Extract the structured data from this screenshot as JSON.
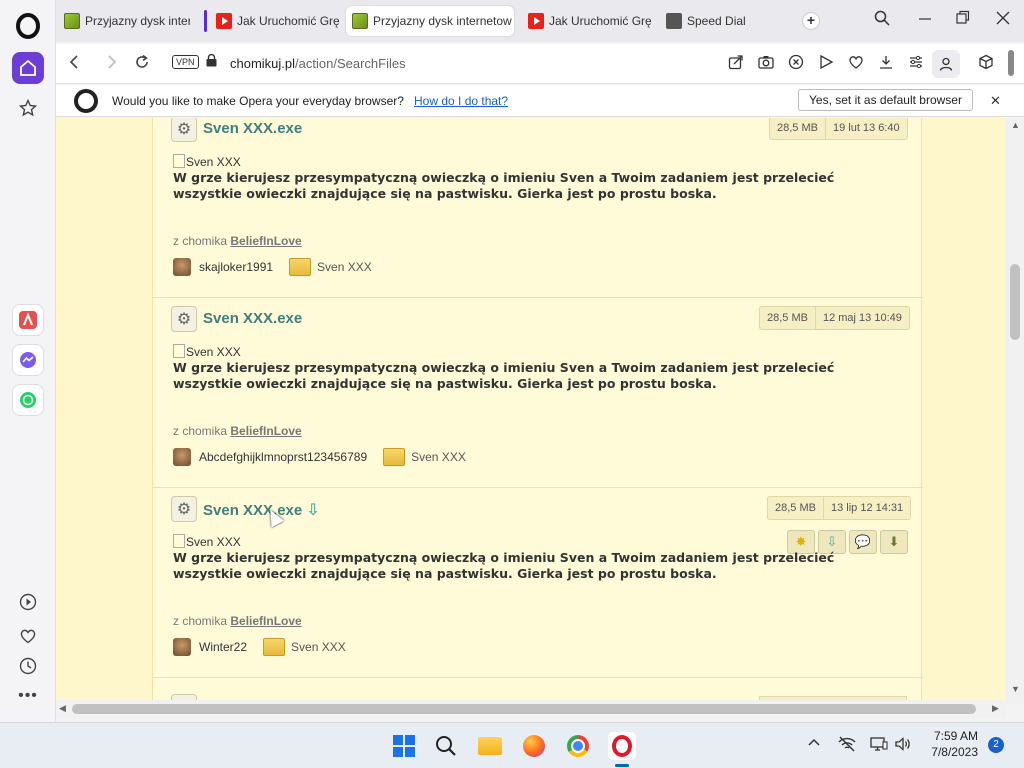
{
  "tabs": [
    {
      "label": "Przyjazny dysk intern",
      "favicon": "chomikuj-favicon",
      "active": false
    },
    {
      "label": "Jak Uruchomić Grę",
      "favicon": "youtube-favicon",
      "active": false
    },
    {
      "label": "Przyjazny dysk internetow",
      "favicon": "chomikuj-favicon",
      "active": true
    },
    {
      "label": "Jak Uruchomić Grę",
      "favicon": "youtube-favicon",
      "active": false
    },
    {
      "label": "Speed Dial",
      "favicon": "speed-dial-favicon",
      "active": false
    }
  ],
  "address": {
    "vpn_label": "VPN",
    "domain": "chomikuj.pl",
    "path": "/action/SearchFiles"
  },
  "infobar": {
    "message": "Would you like to make Opera your everyday browser?",
    "link": "How do I do that?",
    "button": "Yes, set it as default browser"
  },
  "files": [
    {
      "title": "Sven XXX.exe",
      "size": "28,5 MB",
      "date": "19 lut 13 6:40",
      "img_alt": "Sven XXX",
      "description": "W grze kierujesz przesympatyczną owieczką o imieniu Sven a Twoim zadaniem jest przelecieć wszystkie owieczki znajdujące się na pastwisku. Gierka jest po prostu boska.",
      "from_label": "z chomika",
      "from_user": "BeliefInLove",
      "owner": "skajloker1991",
      "folder": "Sven XXX"
    },
    {
      "title": "Sven XXX.exe",
      "size": "28,5 MB",
      "date": "12 maj 13 10:49",
      "img_alt": "Sven XXX",
      "description": "W grze kierujesz przesympatyczną owieczką o imieniu Sven a Twoim zadaniem jest przelecieć wszystkie owieczki znajdujące się na pastwisku. Gierka jest po prostu boska.",
      "from_label": "z chomika",
      "from_user": "BeliefInLove",
      "owner": "Abcdefghijklmnoprst123456789",
      "folder": "Sven XXX"
    },
    {
      "title": "Sven XXX.exe",
      "size": "28,5 MB",
      "date": "13 lip 12 14:31",
      "img_alt": "Sven XXX",
      "description": "W grze kierujesz przesympatyczną owieczką o imieniu Sven a Twoim zadaniem jest przelecieć wszystkie owieczki znajdujące się na pastwisku. Gierka jest po prostu boska.",
      "from_label": "z chomika",
      "from_user": "BeliefInLove",
      "owner": "Winter22",
      "folder": "Sven XXX"
    }
  ],
  "taskbar": {
    "time": "7:59 AM",
    "date": "7/8/2023",
    "notifications": "2"
  },
  "colors": {
    "accent": "#6b3fd6",
    "opera_red": "#e3162b",
    "file_title": "#3f7f80",
    "page_bg": "#fff7cc"
  }
}
